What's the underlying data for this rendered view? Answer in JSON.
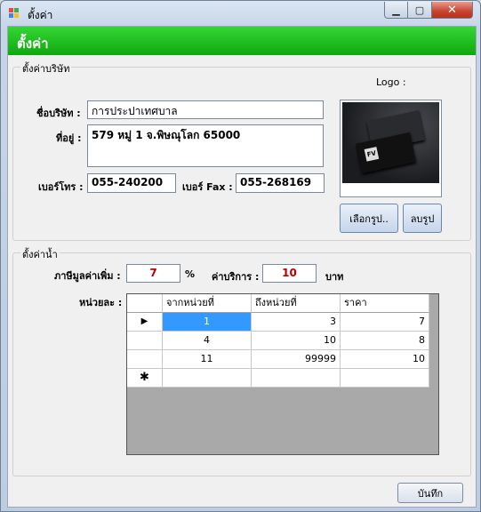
{
  "window": {
    "title": "ตั้งค่า",
    "minimize_glyph": "▁",
    "maximize_glyph": "▢",
    "close_glyph": "✕"
  },
  "header": {
    "title": "ตั้งค่า"
  },
  "company": {
    "legend": "ตั้งค่าบริษัท",
    "name_label": "ชื่อบริษัท :",
    "name_value": "การประปาเทศบาล",
    "address_label": "ที่อยู่ :",
    "address_value": "579 หมู่ 1 จ.พิษณุโลก 65000",
    "phone_label": "เบอร์โทร :",
    "phone_value": "055-240200",
    "fax_label": "เบอร์ Fax :",
    "fax_value": "055-268169",
    "logo_label": "Logo :",
    "select_image_button": "เลือกรูป..",
    "delete_image_button": "ลบรูป"
  },
  "water": {
    "legend": "ตั้งค่าน้ำ",
    "vat_label": "ภาษีมูลค่าเพิ่ม :",
    "vat_value": "7",
    "vat_unit": "%",
    "service_label": "ค่าบริการ :",
    "service_value": "10",
    "service_unit": "บาท",
    "rates_label": "หน่วยละ :",
    "grid": {
      "columns": [
        "จากหน่วยที่",
        "ถึงหน่วยที่",
        "ราคา"
      ],
      "current_row_marker": "▶",
      "new_row_marker": "✱",
      "rows": [
        [
          "1",
          "3",
          "7"
        ],
        [
          "4",
          "10",
          "8"
        ],
        [
          "11",
          "99999",
          "10"
        ]
      ]
    }
  },
  "footer": {
    "save_button": "บันทึก"
  },
  "colors": {
    "header_green": "#0fa80f",
    "selection_blue": "#3399ff",
    "value_red": "#b00000"
  }
}
